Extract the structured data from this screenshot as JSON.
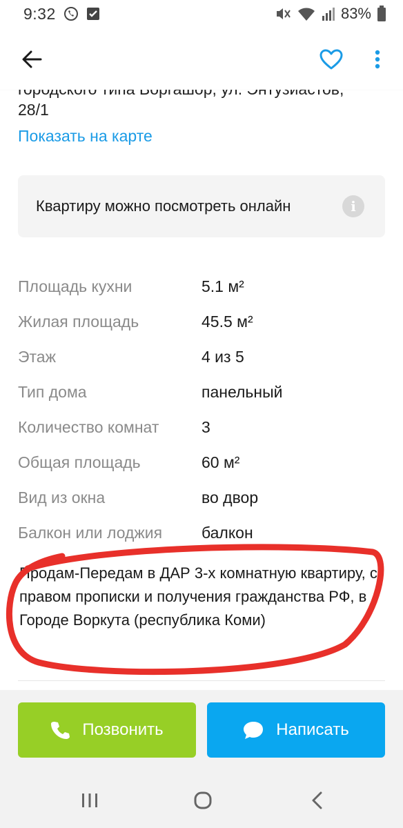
{
  "status_bar": {
    "time": "9:32",
    "battery": "83%",
    "icons": [
      "viber-icon",
      "checkbox-notification-icon",
      "mute-icon",
      "wifi-icon",
      "signal-icon",
      "battery-icon"
    ]
  },
  "app_bar": {
    "icons": [
      "back-arrow-icon",
      "heart-icon",
      "more-vertical-icon"
    ]
  },
  "listing": {
    "address_partial": "городского типа Воргашор, ул. Энтузиастов,",
    "address_end": "28/1",
    "show_on_map": "Показать на карте",
    "online_view": "Квартиру можно посмотреть онлайн",
    "params": [
      {
        "label": "Площадь кухни",
        "value": "5.1 м²"
      },
      {
        "label": "Жилая площадь",
        "value": "45.5 м²"
      },
      {
        "label": "Этаж",
        "value": "4 из 5"
      },
      {
        "label": "Тип дома",
        "value": "панельный"
      },
      {
        "label": "Количество комнат",
        "value": "3"
      },
      {
        "label": "Общая площадь",
        "value": "60 м²"
      },
      {
        "label": "Вид из окна",
        "value": "во двор"
      },
      {
        "label": "Балкон или лоджия",
        "value": "балкон"
      }
    ],
    "description": "Продам-Передам в ДАР 3-х комнатную квартиру, с правом прописки и получения гражданства РФ, в Городе Воркута (республика Коми)"
  },
  "actions": {
    "call_label": "Позвонить",
    "message_label": "Написать"
  },
  "colors": {
    "accent_blue": "#1a9be6",
    "call_green": "#97cf26",
    "message_blue": "#0aa7f0",
    "annotation_red": "#e8302a"
  }
}
